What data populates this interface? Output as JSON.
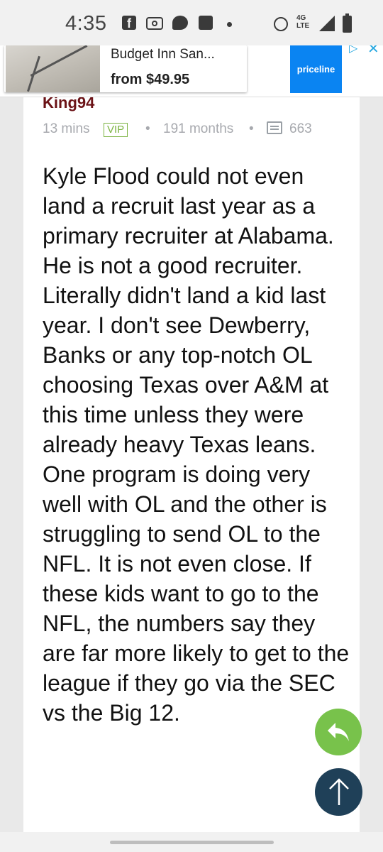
{
  "status_bar": {
    "time": "4:35",
    "icons": [
      "facebook-icon",
      "radio-icon",
      "chat-icon",
      "image-icon",
      "dot-icon",
      "alarm-icon",
      "network-4g-lte-icon",
      "signal-icon",
      "battery-icon"
    ],
    "network_label": "4G LTE"
  },
  "ad": {
    "title": "Budget Inn San...",
    "price": "from $49.95",
    "cta_label": "priceline",
    "cta_color": "#0a84f2"
  },
  "post": {
    "username": "King94",
    "time_ago": "13 mins",
    "badge": "VIP",
    "membership": "191 months",
    "message_count": "663",
    "body": "Kyle Flood could not even land a recruit last year as a primary recruiter at Alabama. He is not a good recruiter. Literally didn't land a kid last year. I don't see Dewberry, Banks or any top-notch OL choosing Texas over A&M at this time unless they were already heavy Texas leans. One program is doing very well with OL and the other is struggling to send OL to the NFL. It is not even close. If these kids want to go to the NFL, the numbers say they are far more likely to get to the league if they go via the SEC vs the Big 12."
  },
  "colors": {
    "username": "#6b1216",
    "vip": "#7cb342",
    "reply_fab": "#78c24b",
    "top_fab": "#1f4058"
  }
}
